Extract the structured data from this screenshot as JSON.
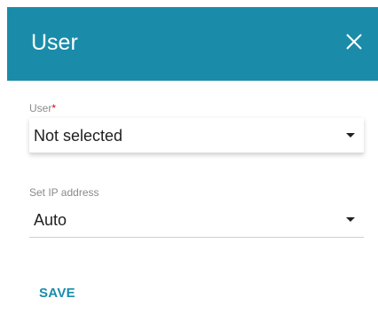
{
  "dialog": {
    "title": "User",
    "close_icon": "close-icon",
    "header_color": "#1a8caa"
  },
  "user_field": {
    "label": "User",
    "required_mark": "*",
    "value": "Not selected"
  },
  "ip_field": {
    "label": "Set IP address",
    "value": "Auto"
  },
  "actions": {
    "save_label": "SAVE"
  }
}
